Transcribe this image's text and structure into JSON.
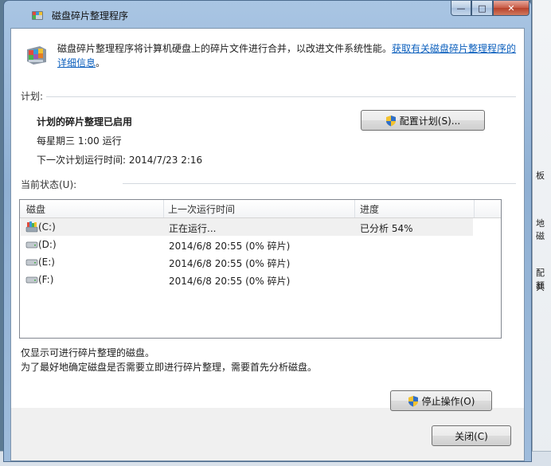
{
  "window": {
    "title": "磁盘碎片整理程序",
    "controls": {
      "minimize": "—",
      "maximize": "□",
      "close": "✕"
    }
  },
  "intro": {
    "text": "磁盘碎片整理程序将计算机硬盘上的碎片文件进行合并，以改进文件系统性能。",
    "link": "获取有关磁盘碎片整理程序的详细信息",
    "period": "。"
  },
  "schedule": {
    "section_label": "计划:",
    "status": "计划的碎片整理已启用",
    "frequency": "每星期三  1:00 运行",
    "next_run": "下一次计划运行时间: 2014/7/23 2:16",
    "configure_button": "配置计划(S)..."
  },
  "current_status": {
    "section_label": "当前状态(U):",
    "columns": [
      "磁盘",
      "上一次运行时间",
      "进度"
    ],
    "rows": [
      {
        "disk": "(C:)",
        "last_run": "正在运行...",
        "progress": "已分析 54%",
        "icon": "defrag-drive-icon",
        "selected": true
      },
      {
        "disk": "(D:)",
        "last_run": "2014/6/8 20:55 (0% 碎片)",
        "progress": "",
        "icon": "drive-icon",
        "selected": false
      },
      {
        "disk": "(E:)",
        "last_run": "2014/6/8 20:55 (0% 碎片)",
        "progress": "",
        "icon": "drive-icon",
        "selected": false
      },
      {
        "disk": "(F:)",
        "last_run": "2014/6/8 20:55 (0% 碎片)",
        "progress": "",
        "icon": "drive-icon",
        "selected": false
      }
    ]
  },
  "notes": {
    "line1": "仅显示可进行碎片整理的磁盘。",
    "line2": "为了最好地确定磁盘是否需要立即进行碎片整理，需要首先分析磁盘。"
  },
  "actions": {
    "stop_button": "停止操作(O)",
    "close_button": "关闭(C)"
  },
  "background": {
    "right_fragments": [
      "板",
      "地磁",
      "配额",
      "共"
    ]
  },
  "icons": {
    "app": "defrag-app-icon",
    "shield": "uac-shield-icon"
  }
}
